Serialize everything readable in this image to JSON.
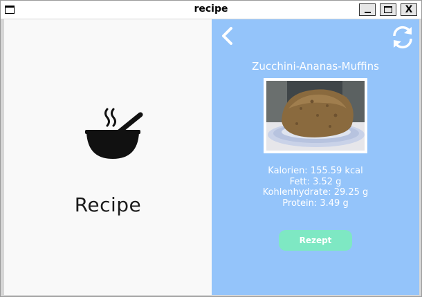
{
  "window": {
    "title": "recipe",
    "minimize_icon": "minimize-icon",
    "maximize_icon": "maximize-icon",
    "close_label": "X"
  },
  "left": {
    "logo_icon": "bowl-steam-icon",
    "logo_text": "Recipe"
  },
  "right": {
    "back_icon": "chevron-left-icon",
    "refresh_icon": "refresh-icon",
    "recipe_name": "Zucchini-Ananas-Muffins",
    "image_alt": "muffin-on-plate",
    "nutrition": {
      "calories": "Kalorien: 155.59 kcal",
      "fat": "Fett: 3.52 g",
      "carbs": "Kohlenhydrate: 29.25 g",
      "protein": "Protein: 3.49 g"
    },
    "recipe_button": "Rezept"
  },
  "colors": {
    "left_bg": "#f9f9f9",
    "right_bg": "#94c4fa",
    "button_bg": "#7ee8c3",
    "text_on_blue": "#ffffff"
  }
}
